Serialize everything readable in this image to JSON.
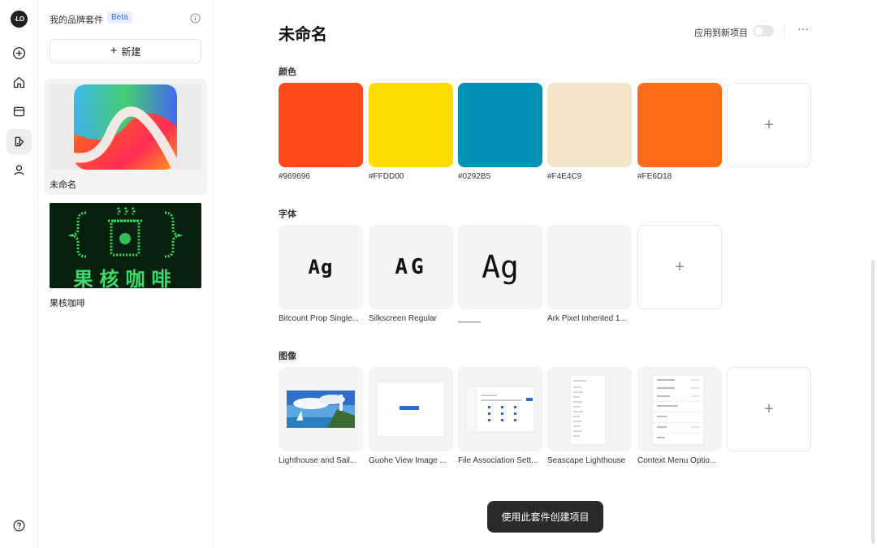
{
  "app": {
    "logo_text": "-LO"
  },
  "rail": {
    "items": [
      {
        "icon": "add-circle-icon"
      },
      {
        "icon": "home-icon"
      },
      {
        "icon": "folder-icon"
      },
      {
        "icon": "brand-kit-icon",
        "active": true
      },
      {
        "icon": "user-icon"
      }
    ],
    "help_icon": "help-icon"
  },
  "kits": {
    "title": "我的品牌套件",
    "beta": "Beta",
    "new_label": "新建",
    "items": [
      {
        "name": "未命名",
        "selected": true
      },
      {
        "name": "果核咖啡",
        "selected": false,
        "thumb_text": "果核咖啡"
      }
    ]
  },
  "main": {
    "title": "未命名",
    "apply_label": "应用到新项目",
    "apply_enabled": false,
    "more": "···",
    "colors_label": "颜色",
    "colors": [
      {
        "hex": "#969696",
        "swatch": "#FF4A1C"
      },
      {
        "hex": "#FFDD00",
        "swatch": "#FFDD00"
      },
      {
        "hex": "#0292B5",
        "swatch": "#0292B5"
      },
      {
        "hex": "#F4E4C9",
        "swatch": "#F4E4C9"
      },
      {
        "hex": "#FE6D18",
        "swatch": "#FE6D18"
      }
    ],
    "fonts_label": "字体",
    "fonts": [
      {
        "name": "Bitcount Prop Single...",
        "sample": "Ag"
      },
      {
        "name": "Silkscreen Regular",
        "sample": "AG"
      },
      {
        "name": "_____",
        "sample": "Ag"
      },
      {
        "name": "Ark Pixel Inherited 1...",
        "sample": ""
      }
    ],
    "images_label": "图像",
    "images": [
      {
        "name": "Lighthouse and Sail..."
      },
      {
        "name": "Guohe View Image ..."
      },
      {
        "name": "File Association Sett..."
      },
      {
        "name": "Seascape Lighthouse"
      },
      {
        "name": "Context Menu Optio..."
      }
    ],
    "add_symbol": "+",
    "create_button": "使用此套件创建项目"
  }
}
